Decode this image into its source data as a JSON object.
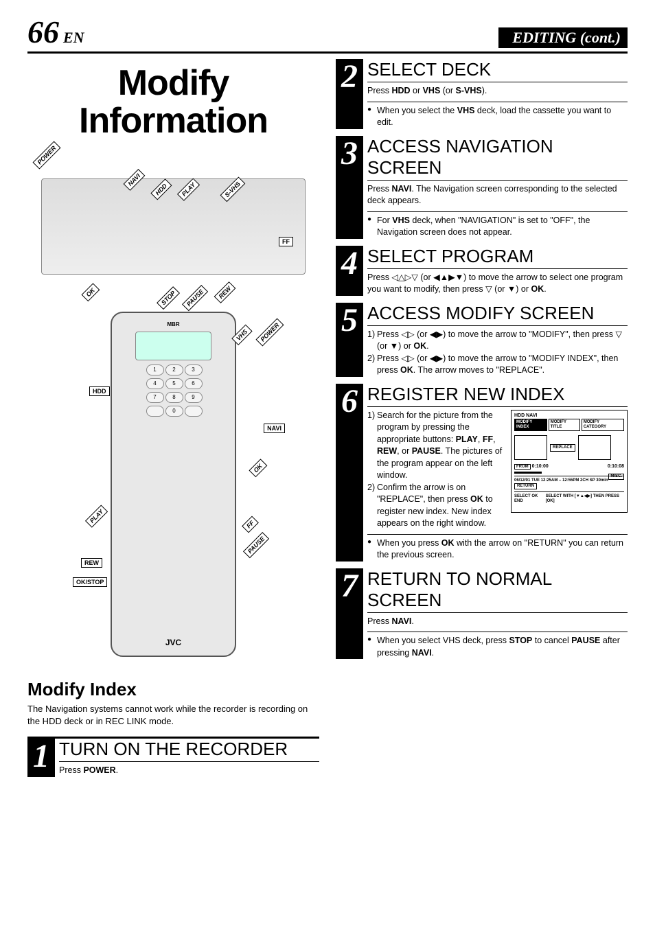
{
  "header": {
    "page_number": "66",
    "lang": "EN",
    "section": "EDITING (cont.)"
  },
  "main_title": "Modify Information",
  "device_callouts": {
    "power": "POWER",
    "navi": "NAVI",
    "hdd": "HDD",
    "play": "PLAY",
    "svhs": "S-VHS",
    "ok": "OK",
    "stop": "STOP",
    "pause": "PAUSE",
    "rew": "REW",
    "ff": "FF"
  },
  "remote_callouts": {
    "mbr": "MBR",
    "vhs": "VHS",
    "power": "POWER",
    "hdd": "HDD",
    "navi": "NAVI",
    "ok": "OK",
    "play": "PLAY",
    "ff": "FF",
    "pause": "PAUSE",
    "rew": "REW",
    "okstop": "OK/STOP",
    "brand": "JVC",
    "keypad": [
      "1",
      "2",
      "3",
      "4",
      "5",
      "6",
      "7",
      "8",
      "9",
      "0"
    ]
  },
  "modify_index": {
    "title": "Modify Index",
    "text": "The Navigation systems cannot work while the recorder is recording on the HDD deck or in REC LINK mode."
  },
  "steps": {
    "s1": {
      "num": "1",
      "title": "TURN ON THE RECORDER",
      "text_pre": "Press ",
      "text_bold": "POWER",
      "text_post": "."
    },
    "s2": {
      "num": "2",
      "title": "SELECT DECK",
      "text": "Press <b>HDD</b> or <b>VHS</b> (or <b>S-VHS</b>).",
      "bullet": "When you select the <b>VHS</b> deck, load the cassette you want to edit."
    },
    "s3": {
      "num": "3",
      "title": "ACCESS NAVIGATION SCREEN",
      "text": "Press <b>NAVI</b>. The Navigation screen corresponding to the selected deck appears.",
      "bullet": "For <b>VHS</b> deck, when \"NAVIGATION\" is set to \"OFF\", the Navigation screen does not appear."
    },
    "s4": {
      "num": "4",
      "title": "SELECT PROGRAM",
      "text": "Press ◁△▷▽ (or ◀▲▶▼) to move the arrow to select one program you want to modify, then press ▽ (or ▼) or <b>OK</b>."
    },
    "s5": {
      "num": "5",
      "title": "ACCESS MODIFY SCREEN",
      "item1": "Press ◁▷ (or ◀▶) to move the arrow to \"MODIFY\", then press ▽ (or ▼) or <b>OK</b>.",
      "item2": "Press ◁▷ (or ◀▶) to move the arrow to \"MODIFY INDEX\", then press <b>OK</b>. The arrow moves to \"REPLACE\"."
    },
    "s6": {
      "num": "6",
      "title": "REGISTER NEW INDEX",
      "item1": "Search for the picture from the program by pressing the appropriate buttons: <b>PLAY</b>, <b>FF</b>, <b>REW</b>, or <b>PAUSE</b>. The pictures of the program appear on the left window.",
      "item2": "Confirm the arrow is on \"REPLACE\", then press <b>OK</b> to register new index. New index appears on the right window.",
      "bullet": "When you press <b>OK</b> with the arrow on \"RETURN\" you can return the previous screen.",
      "diagram": {
        "title": "HDD NAVI",
        "tab1": "MODIFY INDEX",
        "tab2": "MODIFY TITLE",
        "tab3": "MODIFY CATEGORY",
        "replace": "REPLACE",
        "counter_left": "0:10:00",
        "counter_right": "0:10:08",
        "from": "FROM",
        "misc": "MISC.",
        "timeline": "06/12/01 TUE 12:25AM – 12:55PM 2CH SP 30min",
        "return": "RETURN",
        "foot_left": "SELECT OK END",
        "foot_right": "SELECT WITH [▼▲◀▶] THEN PRESS [OK]"
      }
    },
    "s7": {
      "num": "7",
      "title": "RETURN TO NORMAL SCREEN",
      "text": "Press <b>NAVI</b>.",
      "bullet": "When you select VHS deck, press <b>STOP</b> to cancel <b>PAUSE</b> after pressing <b>NAVI</b>."
    }
  }
}
